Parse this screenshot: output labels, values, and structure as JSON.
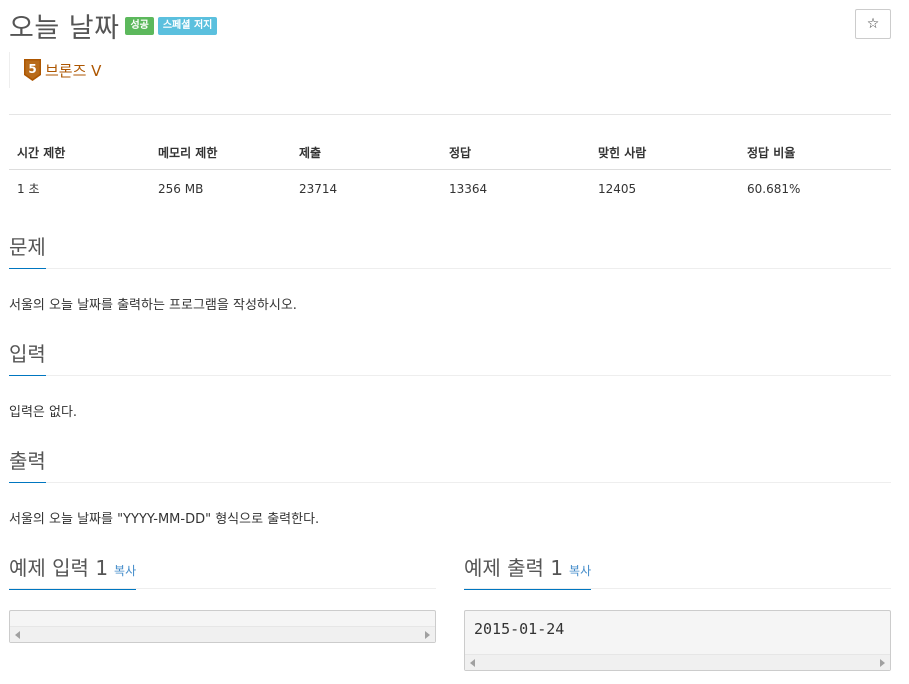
{
  "problem": {
    "title": "오늘 날짜",
    "labels": {
      "success": "성공",
      "special": "스페셜 저지"
    },
    "star_icon": "☆",
    "tier": {
      "badge_number": "5",
      "name": "브론즈 V",
      "color": "#ad5600"
    }
  },
  "info_table": {
    "headers": [
      "시간 제한",
      "메모리 제한",
      "제출",
      "정답",
      "맞힌 사람",
      "정답 비율"
    ],
    "values": [
      "1 초",
      "256 MB",
      "23714",
      "13364",
      "12405",
      "60.681%"
    ]
  },
  "sections": {
    "description": {
      "title": "문제",
      "body": "서울의 오늘 날짜를 출력하는 프로그램을 작성하시오."
    },
    "input": {
      "title": "입력",
      "body": "입력은 없다."
    },
    "output": {
      "title": "출력",
      "body": "서울의 오늘 날짜를 \"YYYY-MM-DD\" 형식으로 출력한다."
    }
  },
  "examples": {
    "input": {
      "title": "예제 입력 1",
      "copy_label": "복사",
      "content": ""
    },
    "output": {
      "title": "예제 출력 1",
      "copy_label": "복사",
      "content": "2015-01-24"
    }
  },
  "colors": {
    "accent": "#0076c0",
    "success": "#5cb85c",
    "info": "#5bc0de",
    "link": "#428bca"
  }
}
